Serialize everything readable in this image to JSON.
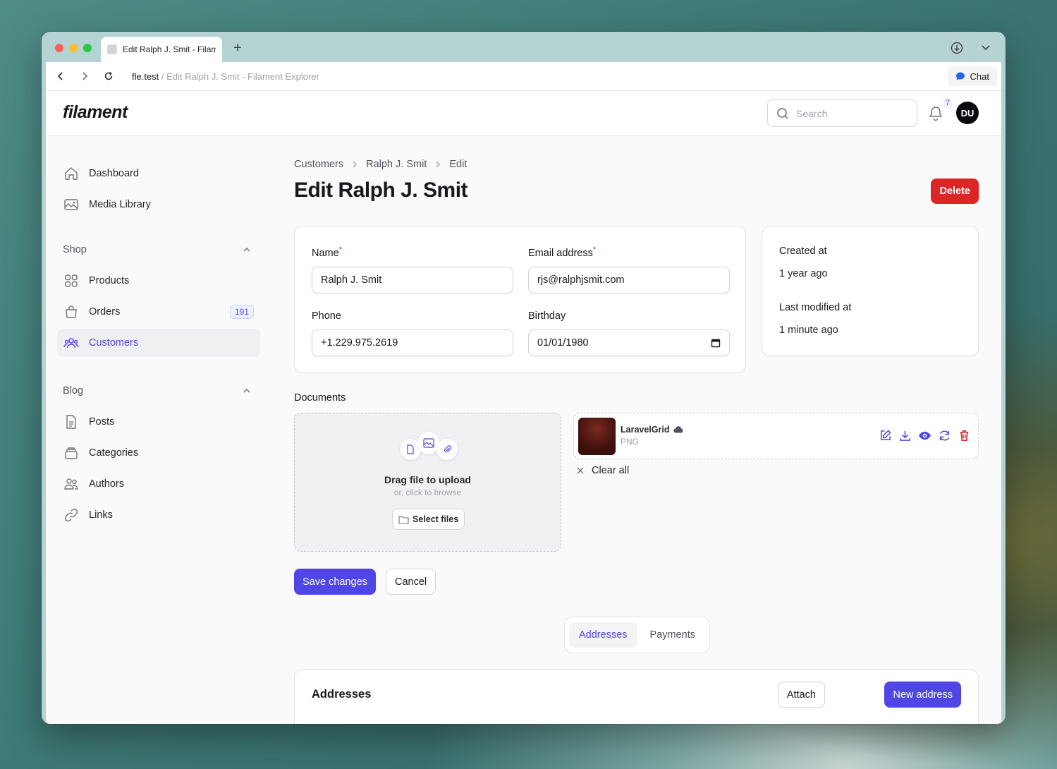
{
  "browser": {
    "tab_title": "Edit Ralph J. Smit - Filament Explorer",
    "url_host": "fle.test",
    "url_rest": " / Edit Ralph J. Smit - Filament Explorer",
    "chat_label": "Chat"
  },
  "header": {
    "logo": "filament",
    "search_placeholder": "Search",
    "notification_count": "7",
    "avatar_initials": "DU"
  },
  "sidebar": {
    "top_items": [
      {
        "label": "Dashboard",
        "icon": "home-icon"
      },
      {
        "label": "Media Library",
        "icon": "image-icon"
      }
    ],
    "groups": [
      {
        "label": "Shop",
        "items": [
          {
            "label": "Products",
            "icon": "grid-icon"
          },
          {
            "label": "Orders",
            "icon": "shopping-bag-icon",
            "badge": "191"
          },
          {
            "label": "Customers",
            "icon": "users-icon",
            "active": true
          }
        ]
      },
      {
        "label": "Blog",
        "items": [
          {
            "label": "Posts",
            "icon": "document-icon"
          },
          {
            "label": "Categories",
            "icon": "archive-icon"
          },
          {
            "label": "Authors",
            "icon": "users-icon"
          },
          {
            "label": "Links",
            "icon": "link-icon"
          }
        ]
      }
    ]
  },
  "breadcrumbs": [
    "Customers",
    "Ralph J. Smit",
    "Edit"
  ],
  "page_title": "Edit Ralph J. Smit",
  "delete_label": "Delete",
  "form": {
    "name_label": "Name",
    "name_value": "Ralph J. Smit",
    "email_label": "Email address",
    "email_value": "rjs@ralphjsmit.com",
    "phone_label": "Phone",
    "phone_value": "+1.229.975.2619",
    "birthday_label": "Birthday",
    "birthday_value": "01/01/1980",
    "required_marker": "*"
  },
  "meta": {
    "created_label": "Created at",
    "created_value": "1 year ago",
    "modified_label": "Last modified at",
    "modified_value": "1 minute ago"
  },
  "documents": {
    "label": "Documents",
    "drop_title": "Drag file to upload",
    "drop_sub": "or, click to browse",
    "select_label": "Select files",
    "file_name": "LaravelGrid",
    "file_type": "PNG",
    "clear_all": "Clear all"
  },
  "actions": {
    "save": "Save changes",
    "cancel": "Cancel"
  },
  "relation_tabs": [
    "Addresses",
    "Payments"
  ],
  "relation": {
    "title": "Addresses",
    "attach": "Attach",
    "new": "New address"
  },
  "colors": {
    "primary": "#4f46e5",
    "danger": "#dc2626"
  }
}
